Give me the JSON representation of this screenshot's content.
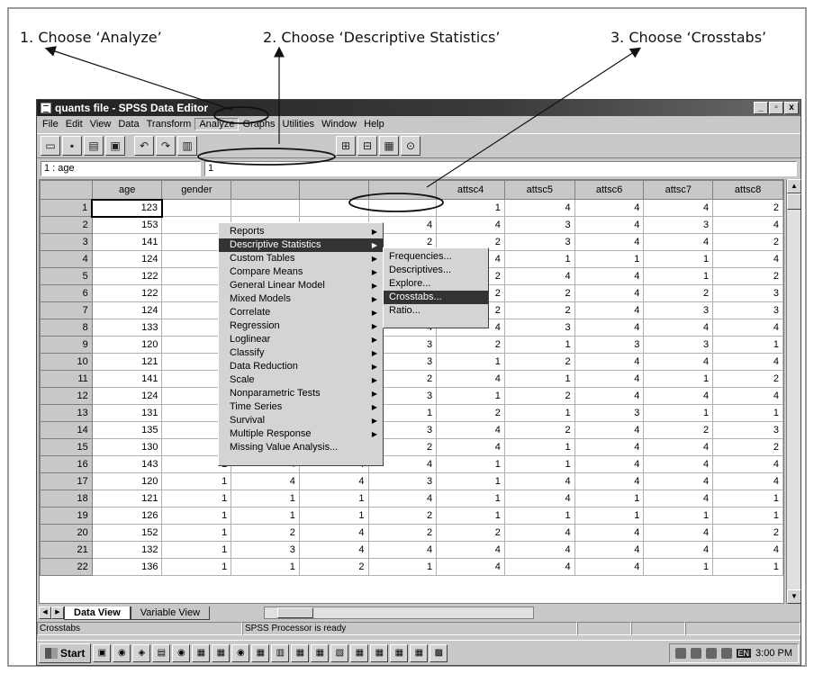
{
  "instructions": {
    "step1": "1. Choose ‘Analyze’",
    "step2": "2. Choose ‘Descriptive Statistics’",
    "step3": "3. Choose ‘Crosstabs’"
  },
  "window": {
    "title": "quants file - SPSS Data Editor",
    "btn_min": "_",
    "btn_max": "▫",
    "btn_close": "x"
  },
  "menubar": [
    "File",
    "Edit",
    "View",
    "Data",
    "Transform",
    "Analyze",
    "Graphs",
    "Utilities",
    "Window",
    "Help"
  ],
  "cellbar": {
    "ref": "1 : age",
    "value": "1"
  },
  "analyze_menu": {
    "items": [
      {
        "label": "Reports",
        "submenu": true
      },
      {
        "label": "Descriptive Statistics",
        "submenu": true
      },
      {
        "label": "Custom Tables",
        "submenu": true
      },
      {
        "label": "Compare Means",
        "submenu": true
      },
      {
        "label": "General Linear Model",
        "submenu": true
      },
      {
        "label": "Mixed Models",
        "submenu": true
      },
      {
        "label": "Correlate",
        "submenu": true
      },
      {
        "label": "Regression",
        "submenu": true
      },
      {
        "label": "Loglinear",
        "submenu": true
      },
      {
        "label": "Classify",
        "submenu": true
      },
      {
        "label": "Data Reduction",
        "submenu": true
      },
      {
        "label": "Scale",
        "submenu": true
      },
      {
        "label": "Nonparametric Tests",
        "submenu": true
      },
      {
        "label": "Time Series",
        "submenu": true
      },
      {
        "label": "Survival",
        "submenu": true
      },
      {
        "label": "Multiple Response",
        "submenu": true
      },
      {
        "label": "Missing Value Analysis...",
        "submenu": false
      }
    ]
  },
  "descriptive_submenu": [
    "Frequencies...",
    "Descriptives...",
    "Explore...",
    "Crosstabs...",
    "Ratio..."
  ],
  "columns": [
    "age",
    "gender",
    "",
    "",
    "",
    "attsc4",
    "attsc5",
    "attsc6",
    "attsc7",
    "attsc8"
  ],
  "rows": [
    [
      "1",
      "123",
      "",
      "",
      "",
      "",
      "1",
      "4",
      "4",
      "4",
      "2"
    ],
    [
      "2",
      "153",
      "",
      "",
      "",
      "4",
      "4",
      "3",
      "4",
      "3",
      "4"
    ],
    [
      "3",
      "141",
      "",
      "",
      "",
      "2",
      "2",
      "3",
      "4",
      "4",
      "2"
    ],
    [
      "4",
      "124",
      "",
      "",
      "",
      "4",
      "4",
      "1",
      "1",
      "1",
      "4"
    ],
    [
      "5",
      "122",
      "",
      "",
      "",
      "3",
      "2",
      "4",
      "4",
      "1",
      "2"
    ],
    [
      "6",
      "122",
      "",
      "",
      "",
      "2",
      "2",
      "2",
      "4",
      "2",
      "3"
    ],
    [
      "7",
      "124",
      "",
      "",
      "",
      "2",
      "2",
      "2",
      "4",
      "3",
      "3"
    ],
    [
      "8",
      "133",
      "",
      "",
      "",
      "4",
      "4",
      "3",
      "4",
      "4",
      "4"
    ],
    [
      "9",
      "120",
      "",
      "",
      "",
      "3",
      "2",
      "1",
      "3",
      "3",
      "1"
    ],
    [
      "10",
      "121",
      "",
      "",
      "",
      "3",
      "1",
      "2",
      "4",
      "4",
      "4"
    ],
    [
      "11",
      "141",
      "",
      "",
      "",
      "2",
      "4",
      "1",
      "4",
      "1",
      "2"
    ],
    [
      "12",
      "124",
      "1",
      "4",
      "4",
      "3",
      "1",
      "2",
      "4",
      "4",
      "4"
    ],
    [
      "13",
      "131",
      "1",
      "1",
      "1",
      "1",
      "2",
      "1",
      "3",
      "1",
      "1"
    ],
    [
      "14",
      "135",
      "1",
      "3",
      "4",
      "3",
      "4",
      "2",
      "4",
      "2",
      "3"
    ],
    [
      "15",
      "130",
      "1",
      "3",
      "3",
      "2",
      "4",
      "1",
      "4",
      "4",
      "2"
    ],
    [
      "16",
      "143",
      "1",
      "4",
      "4",
      "4",
      "1",
      "1",
      "4",
      "4",
      "4"
    ],
    [
      "17",
      "120",
      "1",
      "4",
      "4",
      "3",
      "1",
      "4",
      "4",
      "4",
      "4"
    ],
    [
      "18",
      "121",
      "1",
      "1",
      "1",
      "4",
      "1",
      "4",
      "1",
      "4",
      "1"
    ],
    [
      "19",
      "126",
      "1",
      "1",
      "1",
      "2",
      "1",
      "1",
      "1",
      "1",
      "1"
    ],
    [
      "20",
      "152",
      "1",
      "2",
      "4",
      "2",
      "2",
      "4",
      "4",
      "4",
      "2"
    ],
    [
      "21",
      "132",
      "1",
      "3",
      "4",
      "4",
      "4",
      "4",
      "4",
      "4",
      "4"
    ],
    [
      "22",
      "136",
      "1",
      "1",
      "2",
      "1",
      "4",
      "4",
      "4",
      "1",
      "1"
    ]
  ],
  "tabs": {
    "data_view": "Data View",
    "variable_view": "Variable View"
  },
  "statusbar": {
    "left": "Crosstabs",
    "center": "SPSS Processor  is ready"
  },
  "taskbar": {
    "start": "Start",
    "clock": "3:00 PM",
    "lang": "EN"
  }
}
